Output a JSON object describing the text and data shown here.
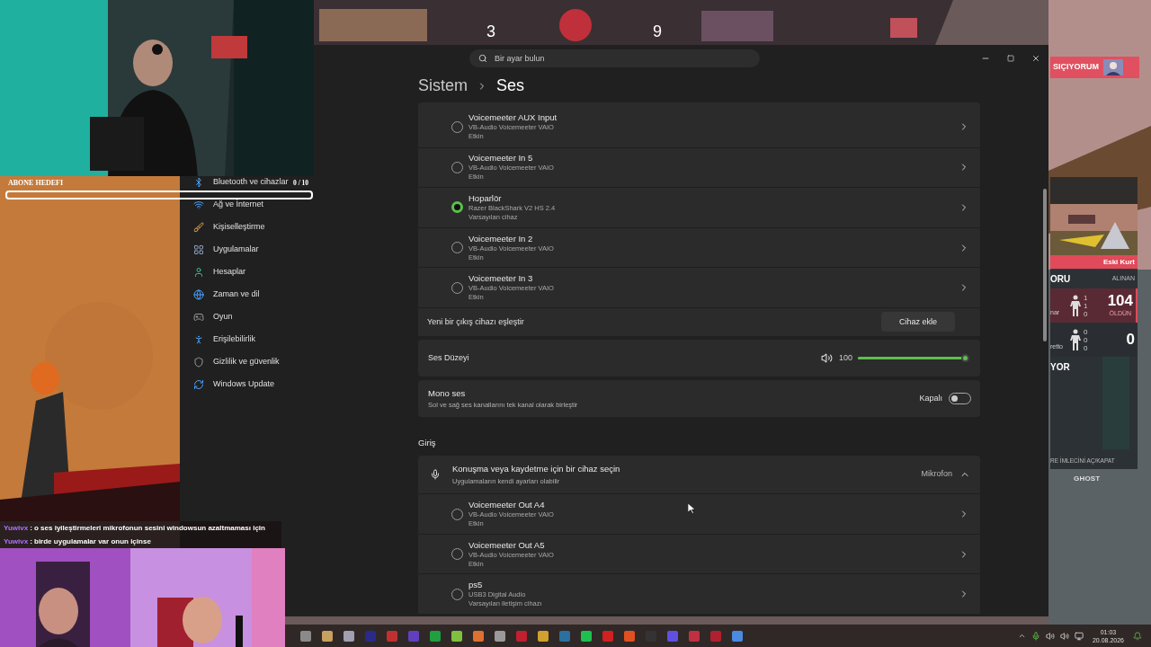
{
  "game_hud": {
    "scores": [
      "3",
      "9"
    ],
    "player_tag": "SIÇIYORUM",
    "card_title": "Eski Kurt",
    "header_left": "ORU",
    "header_right": "ALINAN",
    "stats": [
      {
        "name": "nar",
        "counts": [
          "1",
          "1",
          "0"
        ],
        "value": "104",
        "caption": "ÖLDÜN",
        "highlighted": true
      },
      {
        "name": "retto",
        "counts": [
          "0",
          "0",
          "0"
        ],
        "value": "0",
        "highlighted": false
      }
    ],
    "status": "YOR",
    "hint": "RE İMLECİNİ AÇ/KAPAT",
    "weapon": "GHOST"
  },
  "stream_overlay": {
    "goal": {
      "label": "ABONE HEDEFI",
      "count": "0 / 10",
      "level": 0
    },
    "chat": [
      {
        "user": "Yuwivx",
        "text": ": o ses iyileştirmeleri mikrofonun sesini windowsun azaltmaması için"
      },
      {
        "user": "Yuwivx",
        "text": ": birde uygulamalar var onun içinse"
      }
    ]
  },
  "settings": {
    "search": {
      "placeholder": "Bir ayar bulun"
    },
    "breadcrumb": [
      "Sistem",
      "Ses"
    ],
    "sidebar": [
      {
        "label": "Bluetooth ve cihazlar"
      },
      {
        "label": "Ağ ve İnternet"
      },
      {
        "label": "Kişiselleştirme"
      },
      {
        "label": "Uygulamalar"
      },
      {
        "label": "Hesaplar"
      },
      {
        "label": "Zaman ve dil"
      },
      {
        "label": "Oyun"
      },
      {
        "label": "Erişilebilirlik"
      },
      {
        "label": "Gizlilik ve güvenlik"
      },
      {
        "label": "Windows Update"
      }
    ],
    "output_devices": [
      {
        "name": "Voicemeeter AUX Input",
        "driver": "VB-Audio Voicemeeter VAIO",
        "status": "Etkin",
        "selected": false
      },
      {
        "name": "Voicemeeter In 5",
        "driver": "VB-Audio Voicemeeter VAIO",
        "status": "Etkin",
        "selected": false
      },
      {
        "name": "Hoparlör",
        "driver": "Razer BlackShark V2 HS 2.4",
        "status": "Varsayılan cihaz",
        "selected": true
      },
      {
        "name": "Voicemeeter In 2",
        "driver": "VB-Audio Voicemeeter VAIO",
        "status": "Etkin",
        "selected": false
      },
      {
        "name": "Voicemeeter In 3",
        "driver": "VB-Audio Voicemeeter VAIO",
        "status": "Etkin",
        "selected": false
      }
    ],
    "pair_device": {
      "label": "Yeni bir çıkış cihazı eşleştir",
      "button": "Cihaz ekle"
    },
    "volume": {
      "label": "Ses Düzeyi",
      "reading": "100",
      "level": 1
    },
    "mono_audio": {
      "title": "Mono ses",
      "description": "Sol ve sağ ses kanallarını tek kanal olarak birleştir",
      "state_label": "Kapalı",
      "on": false
    },
    "input": {
      "heading": "Giriş",
      "title": "Konuşma veya kaydetme için bir cihaz seçin",
      "subtitle": "Uygulamaların kendi ayarları olabilir",
      "value": "Mikrofon",
      "expanded": true,
      "devices": [
        {
          "name": "Voicemeeter Out A4",
          "driver": "VB-Audio Voicemeeter VAIO",
          "status": "Etkin",
          "selected": false
        },
        {
          "name": "Voicemeeter Out A5",
          "driver": "VB-Audio Voicemeeter VAIO",
          "status": "Etkin",
          "selected": false
        },
        {
          "name": "ps5",
          "driver": "USB3 Digital Audio",
          "status": "Varsayılan iletişim cihazı",
          "selected": false
        }
      ]
    }
  },
  "taskbar": {
    "time": "01:03",
    "date": "20.08.2026"
  }
}
